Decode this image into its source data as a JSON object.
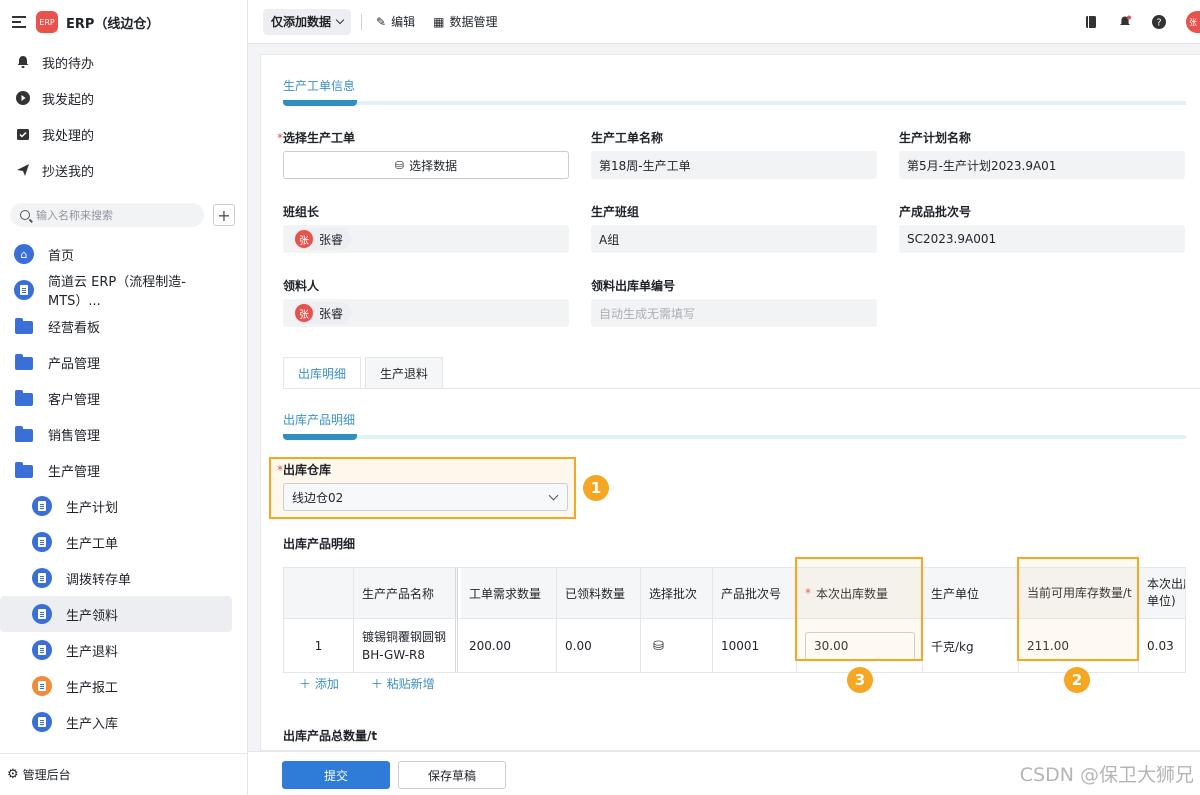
{
  "app": {
    "title": "ERP（线边仓）",
    "logo_text": "ERP",
    "avatar_text": "张"
  },
  "quick": [
    {
      "label": "我的待办",
      "icon": "bell-icon"
    },
    {
      "label": "我发起的",
      "icon": "play-icon"
    },
    {
      "label": "我处理的",
      "icon": "check-box-icon"
    },
    {
      "label": "抄送我的",
      "icon": "send-icon"
    }
  ],
  "search": {
    "placeholder": "输入名称来搜索"
  },
  "nav": [
    {
      "label": "首页"
    },
    {
      "label": "简道云 ERP（流程制造-MTS）..."
    },
    {
      "label": "经营看板"
    },
    {
      "label": "产品管理"
    },
    {
      "label": "客户管理"
    },
    {
      "label": "销售管理"
    },
    {
      "label": "生产管理"
    }
  ],
  "subnav": [
    {
      "label": "生产计划"
    },
    {
      "label": "生产工单"
    },
    {
      "label": "调拨转存单"
    },
    {
      "label": "生产领料"
    },
    {
      "label": "生产退料"
    },
    {
      "label": "生产报工"
    },
    {
      "label": "生产入库"
    }
  ],
  "footer": {
    "label": "管理后台"
  },
  "toolbar": {
    "mode": "仅添加数据",
    "edit": "编辑",
    "data_manage": "数据管理"
  },
  "form": {
    "section1": "生产工单信息",
    "select_order_label": "选择生产工单",
    "select_data_btn": "选择数据",
    "order_name_label": "生产工单名称",
    "order_name_value": "第18周-生产工单",
    "plan_name_label": "生产计划名称",
    "plan_name_value": "第5月-生产计划2023.9A01",
    "leader_label": "班组长",
    "leader_value": "张睿",
    "team_label": "生产班组",
    "team_value": "A组",
    "batch_label": "产成品批次号",
    "batch_value": "SC2023.9A001",
    "picker_label": "领料人",
    "picker_value": "张睿",
    "out_no_label": "领料出库单编号",
    "out_no_placeholder": "自动生成无需填写",
    "req_mark": "*"
  },
  "tabs": [
    {
      "label": "出库明细"
    },
    {
      "label": "生产退料"
    }
  ],
  "detail": {
    "section2": "出库产品明细",
    "warehouse_label": "出库仓库",
    "warehouse_value": "线边仓02",
    "table_title": "出库产品明细",
    "headers": [
      "生产产品名称",
      "工单需求数量",
      "已领料数量",
      "选择批次",
      "产品批次号",
      "本次出库数量",
      "生产单位",
      "当前可用库存数量/t",
      "本次出库单位)"
    ],
    "header_req": "*",
    "row": {
      "index": "1",
      "name": "镀锡铜覆钢圆钢BH-GW-R8",
      "need": "200.00",
      "got": "0.00",
      "batch": "10001",
      "qty": "30.00",
      "unit": "千克/kg",
      "stock": "211.00",
      "cut": "0.03"
    },
    "add": "添加",
    "paste": "粘贴新增",
    "total_label": "出库产品总数量/t"
  },
  "badges": [
    "1",
    "2",
    "3"
  ],
  "actions": {
    "submit": "提交",
    "draft": "保存草稿"
  },
  "watermark": "CSDN @保卫大狮兄",
  "colors": {
    "accent": "#2f7bd8",
    "highlight": "#f5a623",
    "section": "#3a91c6"
  }
}
